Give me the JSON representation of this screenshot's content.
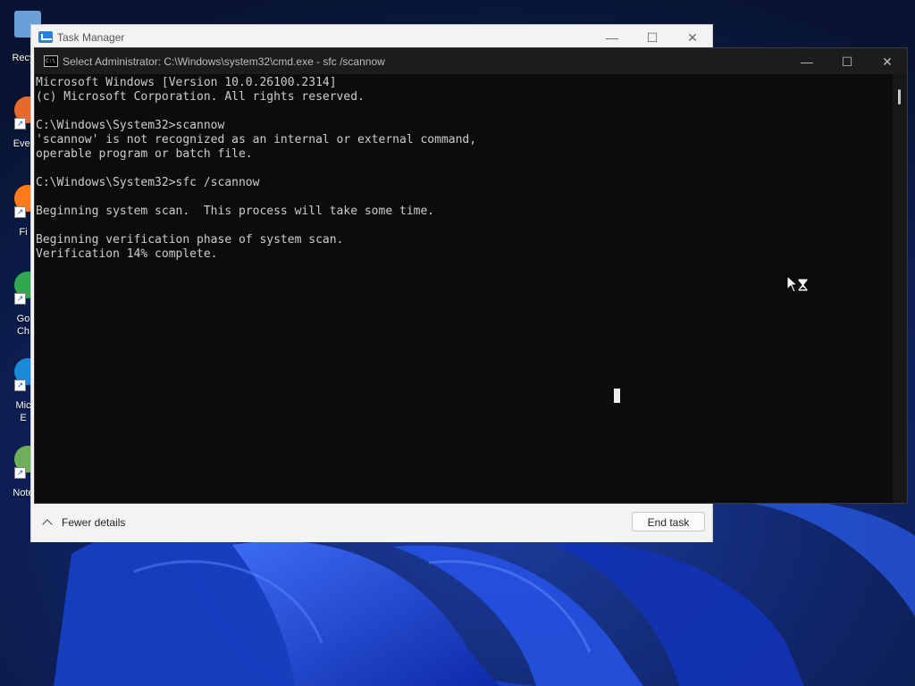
{
  "desktop": {
    "icons": [
      {
        "label": "Recy",
        "icon": "recycle-bin-icon"
      },
      {
        "label": "Ever",
        "icon": "everything-icon"
      },
      {
        "label": "Fi",
        "icon": "firefox-icon"
      },
      {
        "label": "Go\nCh",
        "icon": "chrome-icon"
      },
      {
        "label": "Mic\nE",
        "icon": "edge-icon"
      },
      {
        "label": "Note",
        "icon": "notepad-icon"
      }
    ]
  },
  "task_manager": {
    "title": "Task Manager",
    "minimize": "—",
    "maximize": "☐",
    "close": "✕",
    "fewer_details": "Fewer details",
    "end_task": "End task"
  },
  "cmd_window": {
    "title": "Select Administrator: C:\\Windows\\system32\\cmd.exe - sfc  /scannow",
    "icon_text": "C:\\",
    "minimize": "—",
    "maximize": "☐",
    "close": "✕",
    "lines": [
      "Microsoft Windows [Version 10.0.26100.2314]",
      "(c) Microsoft Corporation. All rights reserved.",
      "",
      "C:\\Windows\\System32>scannow",
      "'scannow' is not recognized as an internal or external command,",
      "operable program or batch file.",
      "",
      "C:\\Windows\\System32>sfc /scannow",
      "",
      "Beginning system scan.  This process will take some time.",
      "",
      "Beginning verification phase of system scan.",
      "Verification 14% complete."
    ]
  },
  "colors": {
    "console_bg": "#0c0c0c",
    "console_text": "#cccccc",
    "wallpaper_accent": "#1f4fe0"
  }
}
